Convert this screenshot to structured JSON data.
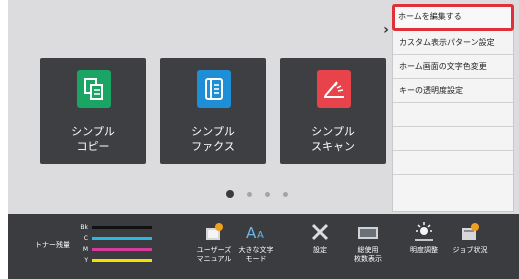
{
  "tiles": [
    {
      "label": "シンプル\nコピー",
      "icon": "copy-icon",
      "color": "#1aa564"
    },
    {
      "label": "シンプル\nファクス",
      "icon": "fax-icon",
      "color": "#1e8fd6"
    },
    {
      "label": "シンプル\nスキャン",
      "icon": "scan-icon",
      "color": "#e8434b"
    }
  ],
  "menu": {
    "items": [
      {
        "label": "ホームを編集する"
      },
      {
        "label": "カスタム表示パターン設定"
      },
      {
        "label": "ホーム画面の文字色変更"
      },
      {
        "label": "キーの透明度設定"
      }
    ]
  },
  "pager": {
    "count": 4,
    "active": 0
  },
  "toner": {
    "label": "トナー残量",
    "rows": [
      {
        "name": "Bk",
        "color": "#111111"
      },
      {
        "name": "C",
        "color": "#27b8e6"
      },
      {
        "name": "M",
        "color": "#d63a9a"
      },
      {
        "name": "Y",
        "color": "#f1e300"
      }
    ]
  },
  "bottom_bar": [
    {
      "label": "ユーザーズ\nマニュアル",
      "icon": "manual-icon"
    },
    {
      "label": "大きな文字\nモード",
      "icon": "large-text-icon"
    },
    {
      "label": "設定",
      "icon": "settings-icon"
    },
    {
      "label": "総使用\n枚数表示",
      "icon": "counter-icon"
    },
    {
      "label": "明度調整",
      "icon": "brightness-icon"
    },
    {
      "label": "ジョブ状況",
      "icon": "job-status-icon"
    }
  ]
}
